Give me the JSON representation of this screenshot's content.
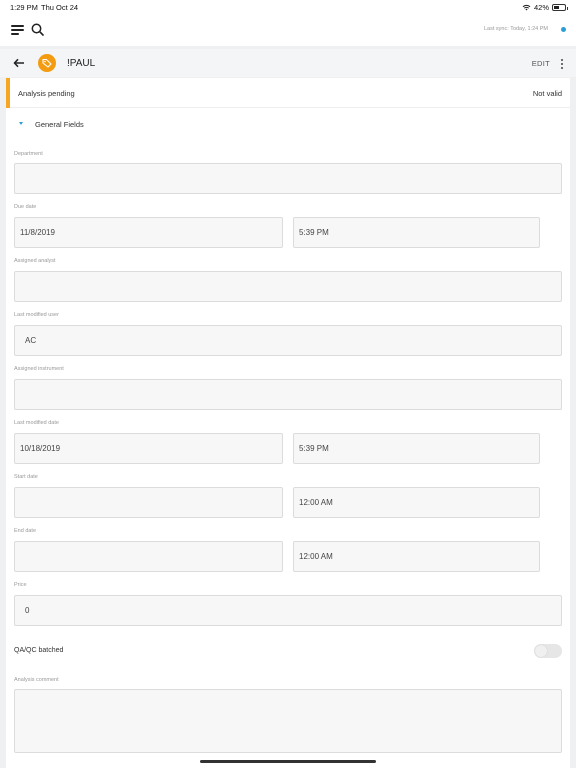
{
  "status_bar": {
    "time": "1:29 PM",
    "date": "Thu Oct 24",
    "battery": "42%",
    "battery_level": 0.42
  },
  "top_bar": {
    "sync_text": "Last sync: Today, 1:24 PM"
  },
  "header": {
    "title": "!PAUL",
    "edit_label": "EDIT"
  },
  "status": {
    "label": "Analysis pending",
    "value": "Not valid",
    "accent_color": "#f5a623"
  },
  "section": {
    "label": "General Fields"
  },
  "fields": {
    "department": {
      "label": "Department",
      "value": ""
    },
    "due_date": {
      "label": "Due date",
      "date": "11/8/2019",
      "time": "5:39 PM"
    },
    "assigned_analyst": {
      "label": "Assigned analyst",
      "value": ""
    },
    "last_modified_user": {
      "label": "Last modified user",
      "value": "AC"
    },
    "assigned_instrument": {
      "label": "Assigned instrument",
      "value": ""
    },
    "last_modified_date": {
      "label": "Last modified date",
      "date": "10/18/2019",
      "time": "5:39 PM"
    },
    "start_date": {
      "label": "Start date",
      "date": "",
      "time": "12:00 AM"
    },
    "end_date": {
      "label": "End date",
      "date": "",
      "time": "12:00 AM"
    },
    "price": {
      "label": "Price",
      "value": "0"
    },
    "qa_qc_batched": {
      "label": "QA/QC batched",
      "checked": false
    },
    "analysis_comment": {
      "label": "Analysis comment",
      "value": ""
    }
  },
  "colors": {
    "accent": "#2a9fd6",
    "avatar": "#f39c12",
    "pending": "#f5a623"
  },
  "icons": [
    "menu-icon",
    "search-icon",
    "wifi-icon",
    "battery-icon",
    "back-arrow-icon",
    "tag-icon",
    "more-vertical-icon",
    "chevron-down-icon"
  ]
}
